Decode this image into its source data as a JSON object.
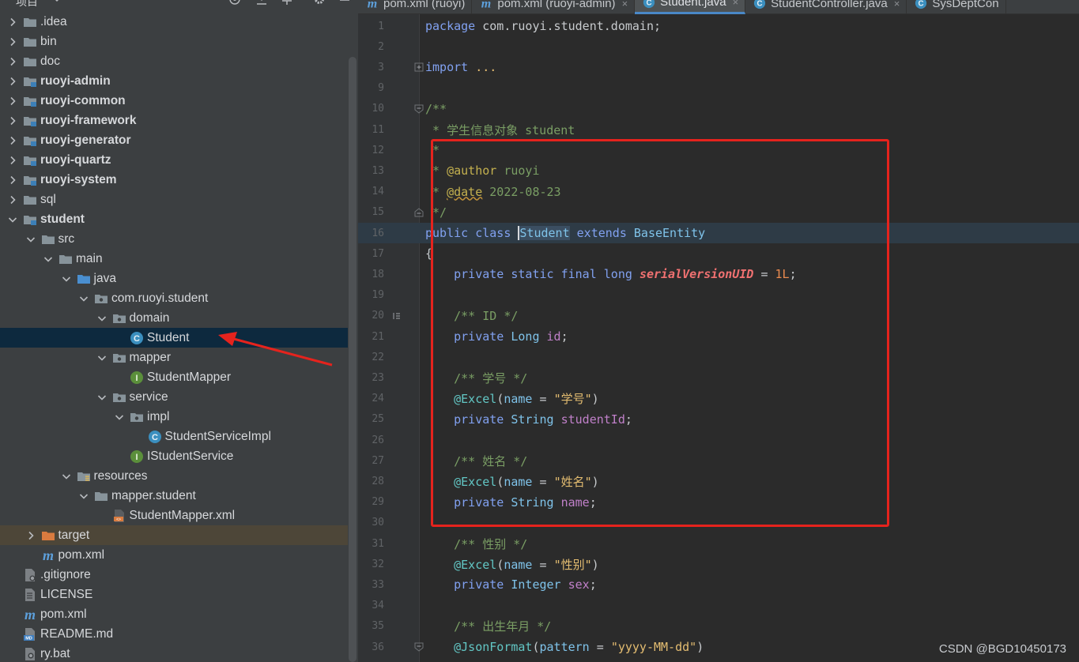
{
  "project_pane": {
    "title": "项目",
    "header_icons": [
      "locate-icon",
      "collapse-all-icon",
      "expand-all-icon",
      "settings-icon",
      "minimize-icon"
    ],
    "tree": [
      {
        "label": ".idea",
        "icon": "folder-icon",
        "depth": 0,
        "expand": "collapsed"
      },
      {
        "label": "bin",
        "icon": "folder-icon",
        "depth": 0,
        "expand": "collapsed"
      },
      {
        "label": "doc",
        "icon": "folder-icon",
        "depth": 0,
        "expand": "collapsed"
      },
      {
        "label": "ruoyi-admin",
        "icon": "module-folder-icon",
        "depth": 0,
        "expand": "collapsed",
        "bold": true
      },
      {
        "label": "ruoyi-common",
        "icon": "module-folder-icon",
        "depth": 0,
        "expand": "collapsed",
        "bold": true
      },
      {
        "label": "ruoyi-framework",
        "icon": "module-folder-icon",
        "depth": 0,
        "expand": "collapsed",
        "bold": true
      },
      {
        "label": "ruoyi-generator",
        "icon": "module-folder-icon",
        "depth": 0,
        "expand": "collapsed",
        "bold": true
      },
      {
        "label": "ruoyi-quartz",
        "icon": "module-folder-icon",
        "depth": 0,
        "expand": "collapsed",
        "bold": true
      },
      {
        "label": "ruoyi-system",
        "icon": "module-folder-icon",
        "depth": 0,
        "expand": "collapsed",
        "bold": true
      },
      {
        "label": "sql",
        "icon": "folder-icon",
        "depth": 0,
        "expand": "collapsed"
      },
      {
        "label": "student",
        "icon": "module-folder-icon",
        "depth": 0,
        "expand": "expanded",
        "bold": true
      },
      {
        "label": "src",
        "icon": "folder-icon",
        "depth": 1,
        "expand": "expanded"
      },
      {
        "label": "main",
        "icon": "folder-icon",
        "depth": 2,
        "expand": "expanded"
      },
      {
        "label": "java",
        "icon": "source-folder-icon",
        "depth": 3,
        "expand": "expanded"
      },
      {
        "label": "com.ruoyi.student",
        "icon": "package-icon",
        "depth": 4,
        "expand": "expanded"
      },
      {
        "label": "domain",
        "icon": "package-icon",
        "depth": 5,
        "expand": "expanded"
      },
      {
        "label": "Student",
        "icon": "class-icon",
        "depth": 6,
        "expand": "none",
        "selected": true
      },
      {
        "label": "mapper",
        "icon": "package-icon",
        "depth": 5,
        "expand": "expanded"
      },
      {
        "label": "StudentMapper",
        "icon": "interface-icon",
        "depth": 6,
        "expand": "none"
      },
      {
        "label": "service",
        "icon": "package-icon",
        "depth": 5,
        "expand": "expanded"
      },
      {
        "label": "impl",
        "icon": "package-icon",
        "depth": 6,
        "expand": "expanded"
      },
      {
        "label": "StudentServiceImpl",
        "icon": "class-icon",
        "depth": 7,
        "expand": "none"
      },
      {
        "label": "IStudentService",
        "icon": "interface-icon",
        "depth": 6,
        "expand": "none"
      },
      {
        "label": "resources",
        "icon": "resources-folder-icon",
        "depth": 3,
        "expand": "expanded"
      },
      {
        "label": "mapper.student",
        "icon": "folder-icon",
        "depth": 4,
        "expand": "expanded"
      },
      {
        "label": "StudentMapper.xml",
        "icon": "xml-file-icon",
        "depth": 5,
        "expand": "none"
      },
      {
        "label": "target",
        "icon": "excluded-folder-icon",
        "depth": 1,
        "expand": "collapsed",
        "target": true
      },
      {
        "label": "pom.xml",
        "icon": "maven-icon",
        "depth": 1,
        "expand": "none"
      },
      {
        "label": ".gitignore",
        "icon": "gitignore-file-icon",
        "depth": 0,
        "expand": "none"
      },
      {
        "label": "LICENSE",
        "icon": "text-file-icon",
        "depth": 0,
        "expand": "none"
      },
      {
        "label": "pom.xml",
        "icon": "maven-icon",
        "depth": 0,
        "expand": "none"
      },
      {
        "label": "README.md",
        "icon": "markdown-file-icon",
        "depth": 0,
        "expand": "none"
      },
      {
        "label": "ry.bat",
        "icon": "bat-file-icon",
        "depth": 0,
        "expand": "none"
      }
    ]
  },
  "tabs": [
    {
      "label": "pom.xml (ruoyi)",
      "icon": "maven-icon",
      "active": false,
      "close": ""
    },
    {
      "label": "pom.xml (ruoyi-admin)",
      "icon": "maven-icon",
      "active": false,
      "close": "×"
    },
    {
      "label": "Student.java",
      "icon": "class-icon",
      "active": true,
      "close": "×"
    },
    {
      "label": "StudentController.java",
      "icon": "class-icon",
      "active": false,
      "close": "×"
    },
    {
      "label": "SysDeptCon",
      "icon": "class-icon",
      "active": false,
      "close": ""
    }
  ],
  "editor": {
    "caret_line": 16,
    "lines": [
      {
        "n": "1",
        "tokens": [
          [
            "kw",
            "package "
          ],
          [
            "pl",
            "com.ruoyi.student.domain;"
          ]
        ]
      },
      {
        "n": "2",
        "tokens": []
      },
      {
        "n": "3",
        "fold": "plus",
        "tokens": [
          [
            "kw",
            "import "
          ],
          [
            "str",
            "..."
          ]
        ]
      },
      {
        "n": "9",
        "tokens": []
      },
      {
        "n": "10",
        "fold": "open",
        "tokens": [
          [
            "doc",
            "/**"
          ]
        ]
      },
      {
        "n": "11",
        "tokens": [
          [
            "doc",
            " * 学生信息对象 student"
          ]
        ]
      },
      {
        "n": "12",
        "tokens": [
          [
            "doc",
            " *"
          ]
        ]
      },
      {
        "n": "13",
        "tokens": [
          [
            "doc",
            " * "
          ],
          [
            "doctag",
            "@author"
          ],
          [
            "doc",
            " ruoyi"
          ]
        ]
      },
      {
        "n": "14",
        "tokens": [
          [
            "doc",
            " * "
          ],
          [
            "doctag",
            "@date"
          ],
          [
            "doc",
            " 2022-08-23"
          ]
        ]
      },
      {
        "n": "15",
        "fold": "close",
        "tokens": [
          [
            "doc",
            " */"
          ]
        ]
      },
      {
        "n": "16",
        "tokens": [
          [
            "kw",
            "public class "
          ],
          [
            "sel",
            "Student"
          ],
          [
            "kw",
            " extends "
          ],
          [
            "typ",
            "BaseEntity"
          ]
        ]
      },
      {
        "n": "17",
        "tokens": [
          [
            "pl",
            "{"
          ]
        ]
      },
      {
        "n": "18",
        "tokens": [
          [
            "kw",
            "    private static final long "
          ],
          [
            "cst",
            "serialVersionUID"
          ],
          [
            "pl",
            " = "
          ],
          [
            "num",
            "1L"
          ],
          [
            "pl",
            ";"
          ]
        ]
      },
      {
        "n": "19",
        "tokens": []
      },
      {
        "n": "20",
        "marker": "implements",
        "tokens": [
          [
            "doc",
            "    /** ID */"
          ]
        ]
      },
      {
        "n": "21",
        "tokens": [
          [
            "kw",
            "    private "
          ],
          [
            "typ",
            "Long "
          ],
          [
            "fld",
            "id"
          ],
          [
            "pl",
            ";"
          ]
        ]
      },
      {
        "n": "22",
        "tokens": []
      },
      {
        "n": "23",
        "tokens": [
          [
            "doc",
            "    /** 学号 */"
          ]
        ]
      },
      {
        "n": "24",
        "tokens": [
          [
            "ann",
            "    @Excel"
          ],
          [
            "pl",
            "("
          ],
          [
            "typ",
            "name"
          ],
          [
            "pl",
            " = "
          ],
          [
            "str",
            "\"学号\""
          ],
          [
            "pl",
            ")"
          ]
        ]
      },
      {
        "n": "25",
        "tokens": [
          [
            "kw",
            "    private "
          ],
          [
            "typ",
            "String "
          ],
          [
            "fld",
            "studentId"
          ],
          [
            "pl",
            ";"
          ]
        ]
      },
      {
        "n": "26",
        "tokens": []
      },
      {
        "n": "27",
        "tokens": [
          [
            "doc",
            "    /** 姓名 */"
          ]
        ]
      },
      {
        "n": "28",
        "tokens": [
          [
            "ann",
            "    @Excel"
          ],
          [
            "pl",
            "("
          ],
          [
            "typ",
            "name"
          ],
          [
            "pl",
            " = "
          ],
          [
            "str",
            "\"姓名\""
          ],
          [
            "pl",
            ")"
          ]
        ]
      },
      {
        "n": "29",
        "tokens": [
          [
            "kw",
            "    private "
          ],
          [
            "typ",
            "String "
          ],
          [
            "fld",
            "name"
          ],
          [
            "pl",
            ";"
          ]
        ]
      },
      {
        "n": "30",
        "tokens": []
      },
      {
        "n": "31",
        "tokens": [
          [
            "doc",
            "    /** 性别 */"
          ]
        ]
      },
      {
        "n": "32",
        "tokens": [
          [
            "ann",
            "    @Excel"
          ],
          [
            "pl",
            "("
          ],
          [
            "typ",
            "name"
          ],
          [
            "pl",
            " = "
          ],
          [
            "str",
            "\"性别\""
          ],
          [
            "pl",
            ")"
          ]
        ]
      },
      {
        "n": "33",
        "tokens": [
          [
            "kw",
            "    private "
          ],
          [
            "typ",
            "Integer "
          ],
          [
            "fld",
            "sex"
          ],
          [
            "pl",
            ";"
          ]
        ]
      },
      {
        "n": "34",
        "tokens": []
      },
      {
        "n": "35",
        "tokens": [
          [
            "doc",
            "    /** 出生年月 */"
          ]
        ]
      },
      {
        "n": "36",
        "fold": "open",
        "tokens": [
          [
            "ann",
            "    @JsonFormat"
          ],
          [
            "pl",
            "("
          ],
          [
            "typ",
            "pattern"
          ],
          [
            "pl",
            " = "
          ],
          [
            "str",
            "\"yyyy-MM-dd\""
          ],
          [
            "pl",
            ")"
          ]
        ]
      }
    ]
  },
  "watermark": "CSDN @BGD10450173",
  "colors": {
    "annotation_red": "#e5231d",
    "selection": "#0d293e",
    "accent_tab": "#4a88c7"
  }
}
